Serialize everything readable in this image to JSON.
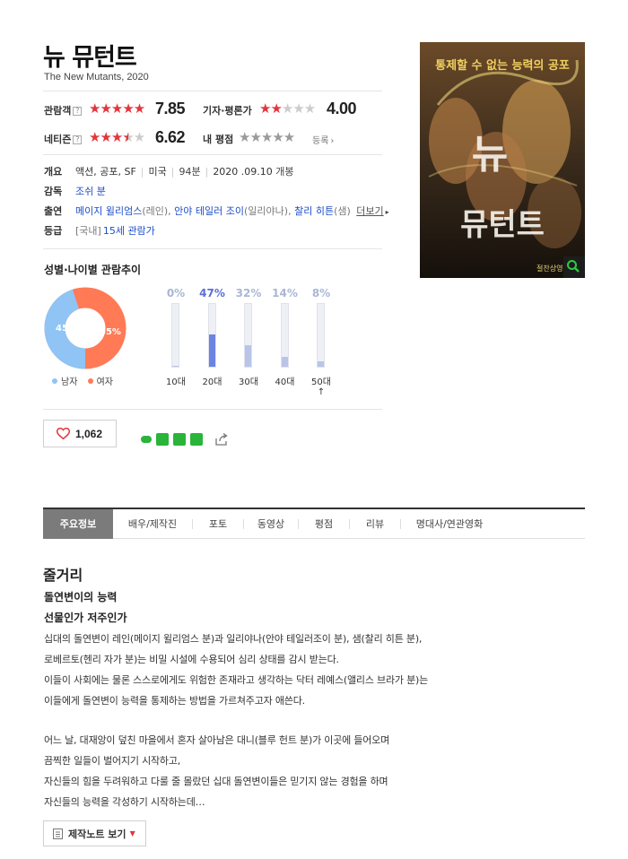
{
  "movie": {
    "title": "뉴 뮤턴트",
    "subtitle": "The New Mutants, 2020"
  },
  "ratings": {
    "audience": {
      "label": "관람객",
      "help": "?",
      "score": "7.85",
      "stars": 4
    },
    "critic": {
      "label": "기자·평론가",
      "score": "4.00",
      "stars": 2
    },
    "netizen": {
      "label": "네티즌",
      "help": "?",
      "score": "6.62",
      "stars": 3.5
    },
    "mine": {
      "label": "내 평점",
      "register": "등록"
    }
  },
  "info": {
    "overview": {
      "label": "개요",
      "genres": "액션, 공포, SF",
      "country": "미국",
      "runtime": "94분",
      "release": "2020 .09.10",
      "release_suffix": " 개봉"
    },
    "director": {
      "label": "감독",
      "name": "조쉬 분"
    },
    "cast": {
      "label": "출연",
      "actors": [
        {
          "name": "메이지 윌리엄스",
          "role": "(레인)"
        },
        {
          "name": "안야 테일러 조이",
          "role": "(일리야나)"
        },
        {
          "name": "찰리 히튼",
          "role": "(샘)"
        }
      ],
      "more": "더보기"
    },
    "rating": {
      "label": "등급",
      "region": "[국내]",
      "grade": "15세 관람가"
    }
  },
  "demographics": {
    "title": "성별·나이별 관람추이",
    "gender": {
      "male_pct": 45,
      "female_pct": 55,
      "male_label": "45%",
      "female_label": "55%",
      "male_name": "남자",
      "female_name": "여자"
    },
    "ages": [
      {
        "label": "10대",
        "pct_label": "0%",
        "pct": 0
      },
      {
        "label": "20대",
        "pct_label": "47%",
        "pct": 47
      },
      {
        "label": "30대",
        "pct_label": "32%",
        "pct": 32
      },
      {
        "label": "40대",
        "pct_label": "14%",
        "pct": 14
      },
      {
        "label": "50대↑",
        "pct_label": "8%",
        "pct": 8
      }
    ],
    "colors": {
      "male": "#8fc4f5",
      "female": "#ff7a55",
      "bar": "#b9c4e8",
      "bar_high": "#6b84e3"
    }
  },
  "like": {
    "count": "1,062"
  },
  "tabs": [
    "주요정보",
    "배우/제작진",
    "포토",
    "동영상",
    "평점",
    "리뷰",
    "명대사/연관영화"
  ],
  "plot": {
    "heading": "줄거리",
    "subheading1": "돌연변이의 능력",
    "subheading2": "선물인가 저주인가",
    "lines": [
      "십대의 돌연변이 레인(메이지 윌리엄스 분)과 일리야나(안야 테일러조이 분), 샘(찰리 히튼 분),",
      " 로베르토(헨리 자가 분)는 비밀 시설에 수용되어 심리 상태를 감시 받는다.",
      " 이들이 사회에는 물론 스스로에게도 위험한 존재라고 생각하는 닥터 레예스(앨리스 브라가 분)는",
      " 이들에게 돌연변이 능력을 통제하는 방법을 가르쳐주고자 애쓴다.",
      " 어느 날, 대재앙이 덮친 마을에서 혼자 살아남은 대니(블루 헌트 분)가 이곳에 들어오며",
      " 끔찍한 일들이 벌어지기 시작하고,",
      " 자신들의 힘을 두려워하고 다룰 줄 몰랐던 십대 돌연변이들은 믿기지 않는 경험을 하며",
      " 자신들의 능력을 각성하기 시작하는데…"
    ],
    "note_button": "제작노트 보기"
  },
  "poster": {
    "tagline": "통제할 수 없는 능력의 공포",
    "title_art": "뉴 뮤턴트"
  }
}
